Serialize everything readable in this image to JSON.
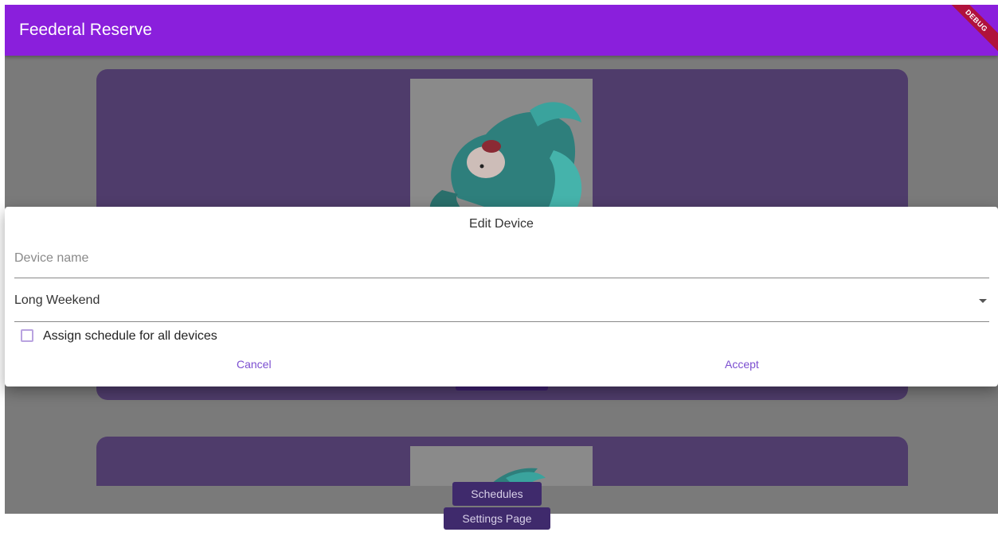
{
  "appbar": {
    "title": "Feederal Reserve",
    "debug_label": "DEBUG"
  },
  "dialog": {
    "title": "Edit Device",
    "device_name_placeholder": "Device name",
    "device_name_value": "",
    "schedule_selected": "Long Weekend",
    "assign_all_label": "Assign schedule for all devices",
    "assign_all_checked": false,
    "cancel_label": "Cancel",
    "accept_label": "Accept"
  },
  "nav": {
    "schedules_label": "Schedules",
    "settings_label": "Settings Page"
  },
  "colors": {
    "appbar": "#8a1fdc",
    "card": "#4f3c6b",
    "accent": "#7b4ed0",
    "debug_banner": "#b0123c"
  },
  "icons": {
    "dropdown": "chevron-down-icon",
    "fish_image": "betta-fish-image"
  }
}
